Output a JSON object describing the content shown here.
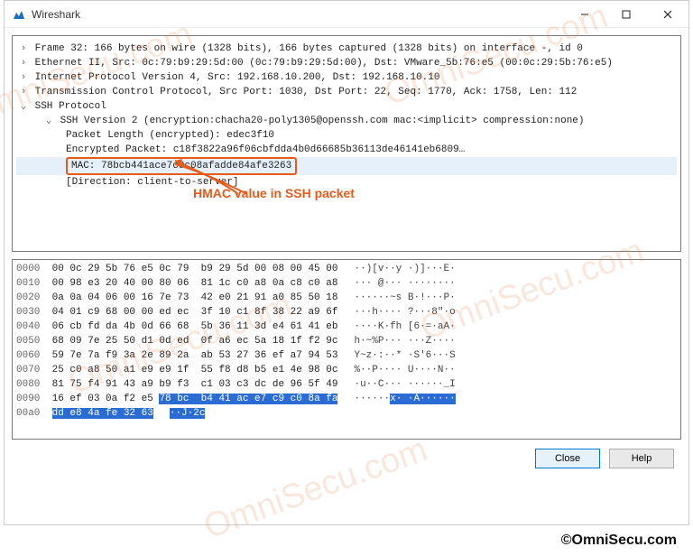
{
  "title": "Wireshark",
  "tree": {
    "frame": "Frame 32: 166 bytes on wire (1328 bits), 166 bytes captured (1328 bits) on interface -, id 0",
    "ethernet": "Ethernet II, Src: 0c:79:b9:29:5d:00 (0c:79:b9:29:5d:00), Dst: VMware_5b:76:e5 (00:0c:29:5b:76:e5)",
    "ip": "Internet Protocol Version 4, Src: 192.168.10.200, Dst: 192.168.10.10",
    "tcp": "Transmission Control Protocol, Src Port: 1030, Dst Port: 22, Seq: 1770, Ack: 1758, Len: 112",
    "ssh": "SSH Protocol",
    "sshv2": "SSH Version 2 (encryption:chacha20-poly1305@openssh.com mac:<implicit> compression:none)",
    "packet_length": "Packet Length (encrypted): edec3f10",
    "encrypted_packet": "Encrypted Packet: c18f3822a96f06cbfdda4b0d66685b36113de46141eb6809…",
    "mac": "MAC: 78bcb441ace7c9c08afadde84afe3263",
    "direction": "[Direction: client-to-server]"
  },
  "annotation": "HMAC value in SSH packet",
  "hex": {
    "rows": [
      {
        "offset": "0000",
        "bytes": "00 0c 29 5b 76 e5 0c 79  b9 29 5d 00 08 00 45 00",
        "ascii": "··)[v··y ·)]···E·"
      },
      {
        "offset": "0010",
        "bytes": "00 98 e3 20 40 00 80 06  81 1c c0 a8 0a c8 c0 a8",
        "ascii": "··· @··· ········"
      },
      {
        "offset": "0020",
        "bytes": "0a 0a 04 06 00 16 7e 73  42 e0 21 91 a0 85 50 18",
        "ascii": "······~s B·!···P·"
      },
      {
        "offset": "0030",
        "bytes": "04 01 c9 68 00 00 ed ec  3f 10 c1 8f 38 22 a9 6f",
        "ascii": "···h···· ?···8\"·o"
      },
      {
        "offset": "0040",
        "bytes": "06 cb fd da 4b 0d 66 68  5b 36 11 3d e4 61 41 eb",
        "ascii": "····K·fh [6·=·aA·"
      },
      {
        "offset": "0050",
        "bytes": "68 09 7e 25 50 d1 0d ed  0f a6 ec 5a 18 1f f2 9c",
        "ascii": "h·~%P··· ···Z····"
      },
      {
        "offset": "0060",
        "bytes": "59 7e 7a f9 3a 2e 89 2a  ab 53 27 36 ef a7 94 53",
        "ascii": "Y~z·:··* ·S'6···S"
      },
      {
        "offset": "0070",
        "bytes": "25 c0 a8 50 a1 e9 e9 1f  55 f8 d8 b5 e1 4e 98 0c",
        "ascii": "%··P···· U····N··"
      },
      {
        "offset": "0080",
        "bytes": "81 75 f4 91 43 a9 b9 f3  c1 03 c3 dc de 96 5f 49",
        "ascii": "·u··C··· ······_I"
      },
      {
        "offset": "0090",
        "bytes_pre": "16 ef 03 0a f2 e5 ",
        "bytes_sel": "78 bc  b4 41 ac e7 c9 c0 8a fa",
        "ascii_pre": "······",
        "ascii_sel": "x· ·A······"
      },
      {
        "offset": "00a0",
        "bytes_sel": "dd e8 4a fe 32 63",
        "ascii_sel": "··J·2c",
        "tail_ascii": ""
      }
    ]
  },
  "buttons": {
    "close": "Close",
    "help": "Help"
  },
  "copyright": "©OmniSecu.com",
  "watermark": "OmniSecu.com"
}
